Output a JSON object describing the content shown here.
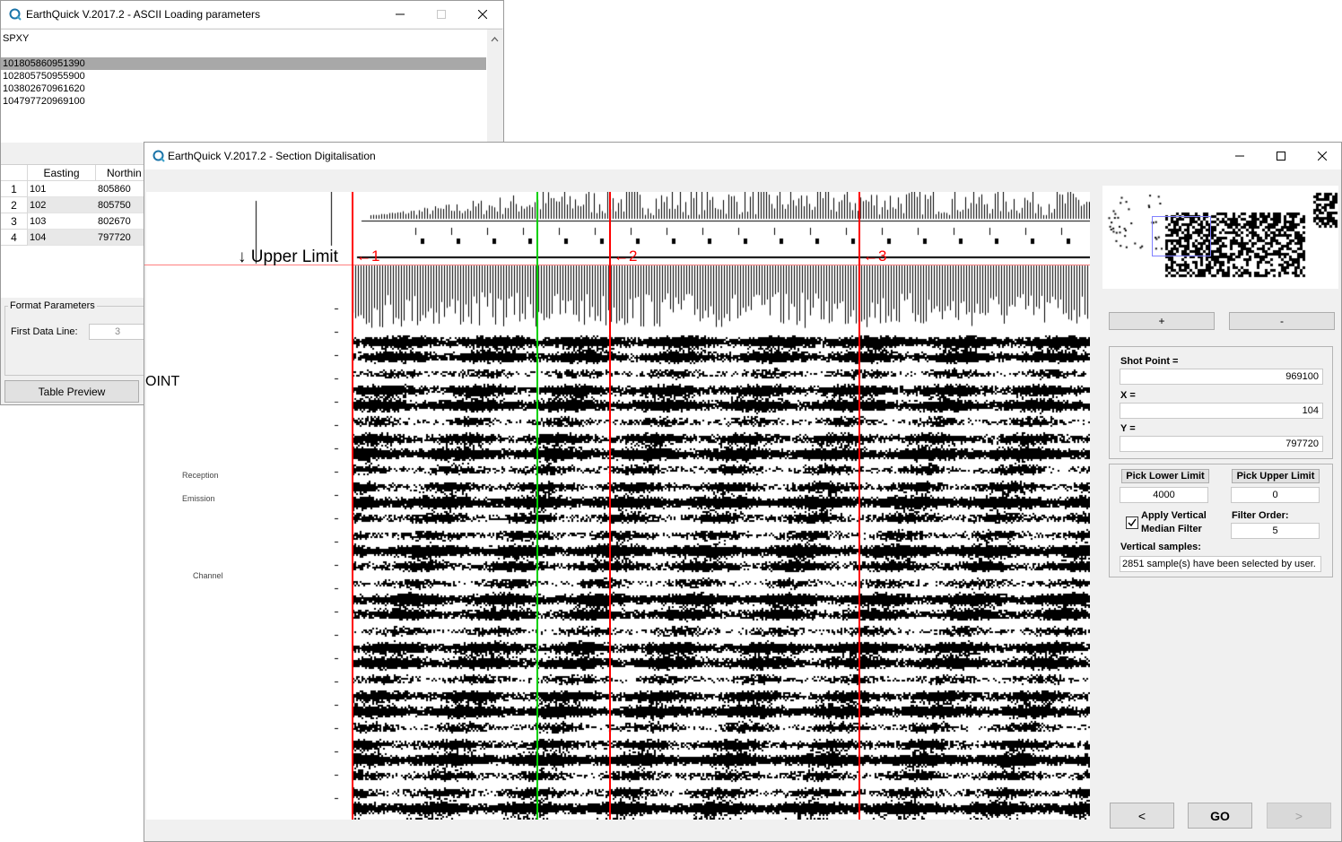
{
  "ascii_window": {
    "title": "EarthQuick V.2017.2 - ASCII Loading parameters",
    "text_lines": [
      "SPXY",
      "",
      "101805860951390",
      "102805750955900",
      "103802670961620",
      "104797720969100"
    ],
    "table": {
      "headers": [
        "Easting",
        "Northin"
      ],
      "rows": [
        {
          "n": "1",
          "easting": "101",
          "northing": "805860"
        },
        {
          "n": "2",
          "easting": "102",
          "northing": "805750"
        },
        {
          "n": "3",
          "easting": "103",
          "northing": "802670"
        },
        {
          "n": "4",
          "easting": "104",
          "northing": "797720"
        }
      ]
    },
    "format_group": "Format Parameters",
    "first_data_line_label": "First Data Line:",
    "first_data_line_value": "3",
    "table_preview_button": "Table Preview"
  },
  "section_window": {
    "title": "EarthQuick V.2017.2 - Section Digitalisation",
    "image_overlay": {
      "upper_limit_label": "↓ Upper Limit",
      "markers": [
        "1",
        "2",
        "3"
      ],
      "side_text": "OINT",
      "faint_labels": [
        "Reception",
        "Emission",
        "Channel"
      ]
    },
    "zoom_in": "+",
    "zoom_out": "-",
    "shot_point_label": "Shot Point =",
    "shot_point_value": "969100",
    "x_label": "X =",
    "x_value": "104",
    "y_label": "Y =",
    "y_value": "797720",
    "pick_lower_label": "Pick Lower Limit",
    "pick_upper_label": "Pick Upper Limit",
    "lower_value": "4000",
    "upper_value": "0",
    "median_filter_label_1": "Apply Vertical",
    "median_filter_label_2": "Median Filter",
    "median_filter_checked": true,
    "filter_order_label": "Filter Order:",
    "filter_order_value": "5",
    "vertical_samples_label": "Vertical samples:",
    "vertical_samples_value": "2851 sample(s) have been selected by user.",
    "prev_button": "<",
    "go_button": "GO",
    "next_button": ">"
  },
  "colors": {
    "marker_red": "#ff0000",
    "selection_green": "#00d000",
    "upper_limit_line": "#ff8080",
    "minimap_box": "#8080ff",
    "app_icon": "#1a73a8"
  },
  "icons": [
    "app-logo-icon",
    "minimize-icon",
    "maximize-icon",
    "close-icon",
    "restore-icon",
    "checkbox-checked-icon",
    "scroll-up-icon"
  ]
}
